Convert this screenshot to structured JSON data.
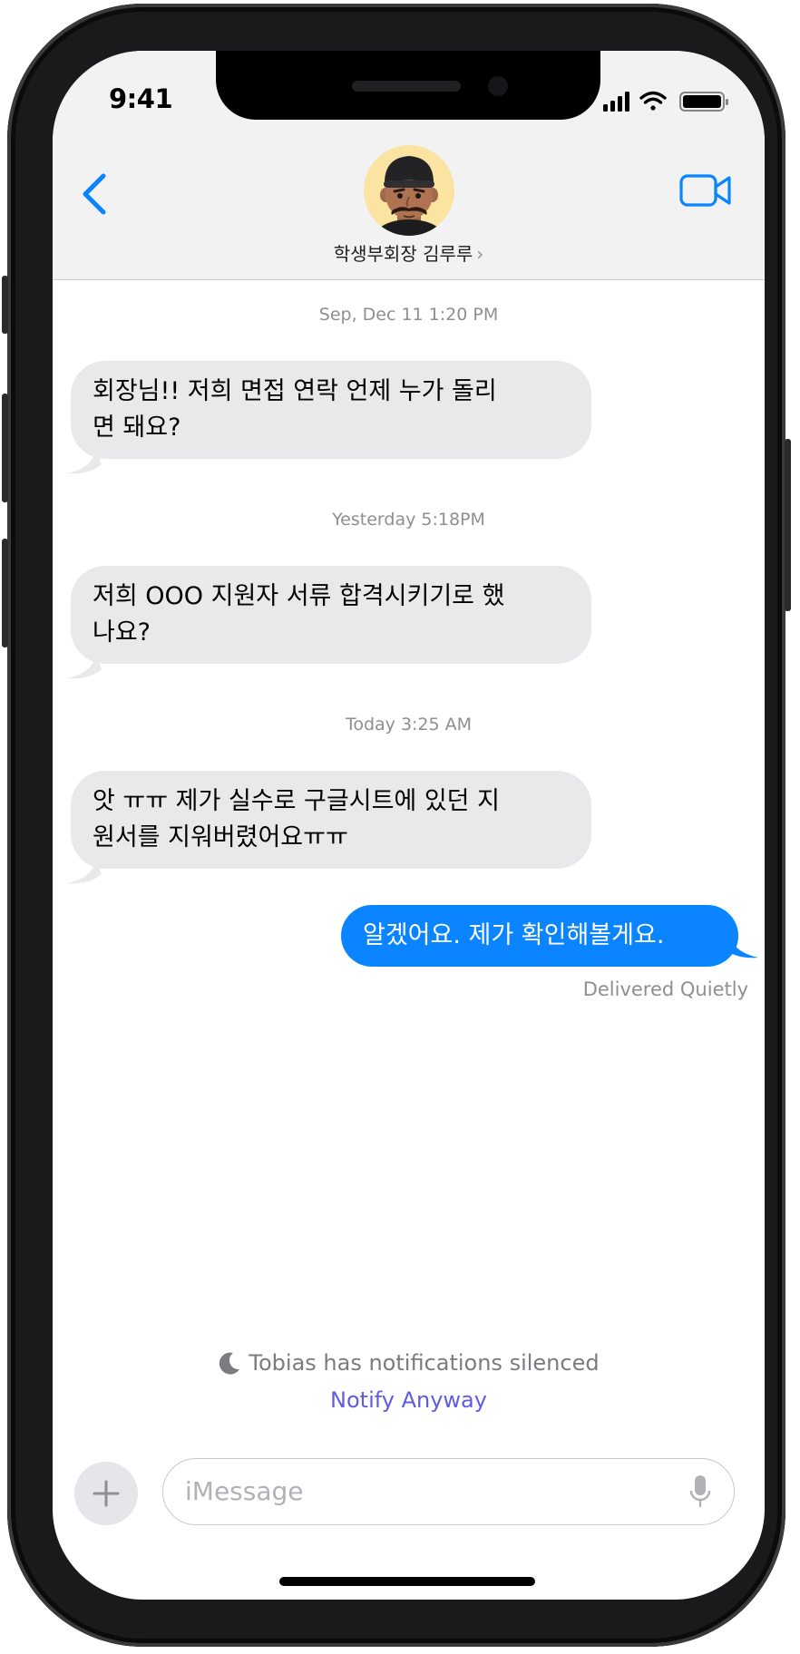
{
  "status_bar": {
    "time": "9:41"
  },
  "header": {
    "contact_name": "학생부회장 김루루",
    "back_icon": "chevron-left-icon",
    "video_icon": "video-camera-icon"
  },
  "messages": [
    {
      "timestamp": "Sep, Dec 11 1:20 PM",
      "direction": "incoming",
      "lines": [
        "회장님!! 저희 면접 연락 언제 누가 돌리",
        "면 돼요?"
      ]
    },
    {
      "timestamp": "Yesterday 5:18PM",
      "direction": "incoming",
      "lines": [
        "저희 OOO 지원자 서류 합격시키기로 했",
        "나요?"
      ]
    },
    {
      "timestamp": "Today 3:25 AM",
      "direction": "incoming",
      "lines": [
        "앗 ㅠㅠ 제가 실수로 구글시트에 있던 지",
        "원서를 지워버렸어요ㅠㅠ"
      ]
    },
    {
      "direction": "outgoing",
      "lines": [
        "알겠어요. 제가 확인해볼게요."
      ]
    }
  ],
  "delivery_status": "Delivered Quietly",
  "focus_notice": {
    "text": "Tobias has notifications silenced",
    "action": "Notify Anyway",
    "icon": "moon-icon"
  },
  "compose": {
    "placeholder": "iMessage",
    "plus_icon": "plus-icon",
    "mic_icon": "microphone-icon"
  },
  "colors": {
    "outgoing_bubble": "#0a84ff",
    "incoming_bubble": "#e9e9eb",
    "link": "#5e5ce6",
    "accent": "#0a84ff"
  }
}
